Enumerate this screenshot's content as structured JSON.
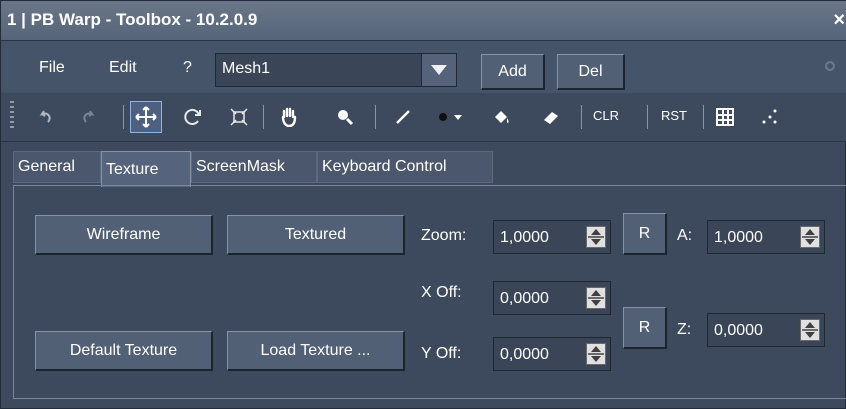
{
  "window": {
    "title": "1 | PB Warp - Toolbox - 10.2.0.9",
    "close_label": "×"
  },
  "menu": {
    "file": "File",
    "edit": "Edit",
    "help": "?"
  },
  "mesh": {
    "selected": "Mesh1",
    "add_label": "Add",
    "del_label": "Del"
  },
  "toolbar": {
    "icons": [
      "undo-icon",
      "redo-icon",
      "move-icon",
      "rotate-icon",
      "scale-icon",
      "hand-icon",
      "zoom-icon",
      "line-icon",
      "brush-icon",
      "fill-icon",
      "eraser-icon",
      "grid-icon",
      "points-icon"
    ],
    "clr_label": "CLR",
    "rst_label": "RST"
  },
  "tabs": [
    "General",
    "Texture",
    "ScreenMask",
    "Keyboard Control"
  ],
  "active_tab": "Texture",
  "texture_panel": {
    "wireframe_label": "Wireframe",
    "textured_label": "Textured",
    "default_texture_label": "Default Texture",
    "load_texture_label": "Load Texture ...",
    "zoom_label": "Zoom:",
    "zoom_value": "1,0000",
    "zoom_reset_label": "R",
    "a_label": "A:",
    "a_value": "1,0000",
    "xoff_label": "X Off:",
    "xoff_value": "0,0000",
    "yoff_label": "Y Off:",
    "yoff_value": "0,0000",
    "offset_reset_label": "R",
    "z_label": "Z:",
    "z_value": "0,0000"
  }
}
